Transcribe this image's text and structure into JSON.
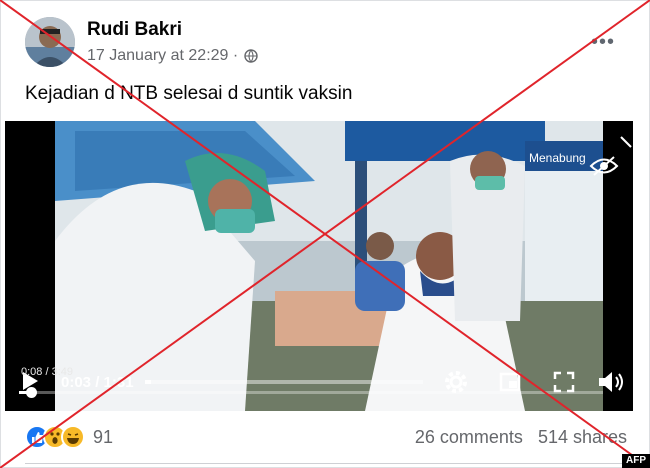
{
  "post": {
    "author": "Rudi Bakri",
    "timestamp": "17 January at 22:29 ·",
    "audience_icon": "globe-icon",
    "text": "Kejadian d NTB selesai d suntik vaksin"
  },
  "video": {
    "hover_time": "0:08 / 3:49",
    "current_time": "0:03 / 1:31",
    "sign_text": "Menabung",
    "progress_fraction": 0.02,
    "controls": [
      "play-icon",
      "settings-icon",
      "miniplayer-icon",
      "fullscreen-icon",
      "volume-icon"
    ]
  },
  "engagement": {
    "reaction_icons": [
      "like-icon",
      "wow-icon",
      "haha-icon"
    ],
    "reaction_count": "91",
    "comments": "26 comments",
    "shares": "514 shares"
  },
  "overlay": {
    "watermark": "AFP",
    "x_color": "#e0242b"
  },
  "colors": {
    "like": "#1877f2",
    "emoji": "#f7b928",
    "meta_text": "#65676b"
  }
}
